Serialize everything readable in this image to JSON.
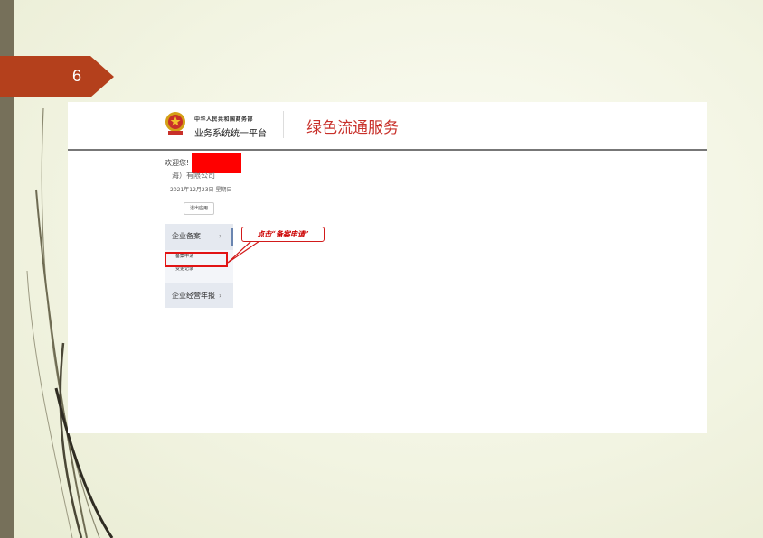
{
  "slide": {
    "number": "6"
  },
  "header": {
    "ministry": "中华人民共和国商务部",
    "platform": "业务系统统一平台",
    "service_title": "绿色流通服务"
  },
  "user": {
    "welcome": "欢迎您!",
    "company": "海）有限公司",
    "date": "2021年12月23日 星期日",
    "logout_label": "退出应用"
  },
  "sidebar": {
    "items": [
      {
        "label": "企业备案",
        "chevron": "›"
      },
      {
        "label": "企业经营年报",
        "chevron": "›"
      }
    ],
    "sub_items": [
      {
        "label": "备案申请"
      },
      {
        "label": "变更记录"
      }
    ]
  },
  "callout": {
    "text": "点击“备案申请”"
  },
  "colors": {
    "accent": "#c8302a",
    "slide_arrow": "#b4401c",
    "highlight": "#e21414"
  }
}
